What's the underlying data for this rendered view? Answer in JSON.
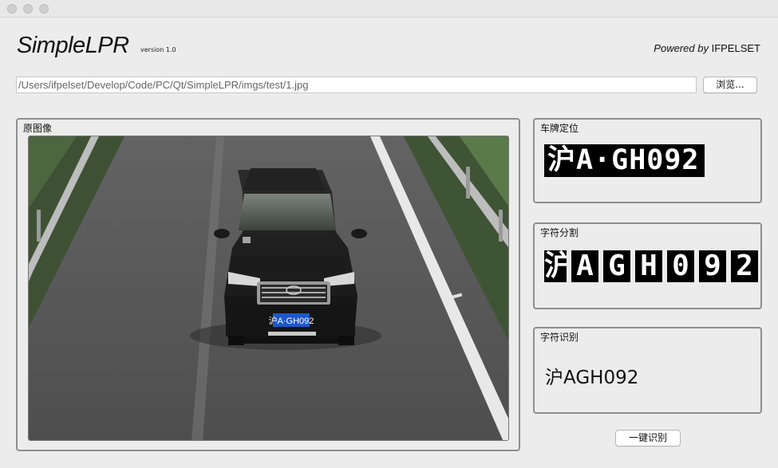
{
  "window": {
    "controls": [
      "close",
      "minimize",
      "zoom"
    ]
  },
  "header": {
    "title": "SimpleLPR",
    "version": "version 1.0",
    "powered_prefix": "Powered by",
    "powered_name": "IFPELSET"
  },
  "file": {
    "path": "/Users/ifpelset/Develop/Code/PC/Qt/SimpleLPR/imgs/test/1.jpg",
    "browse_label": "浏览..."
  },
  "groups": {
    "original_title": "原图像",
    "location_title": "车牌定位",
    "segmentation_title": "字符分割",
    "recognition_title": "字符识别"
  },
  "photo": {
    "plate_text": "沪A·GH092"
  },
  "location": {
    "plate": "沪A·GH092"
  },
  "segmentation": {
    "chars": [
      "沪",
      "A",
      "G",
      "H",
      "0",
      "9",
      "2"
    ]
  },
  "recognition": {
    "result": "沪AGH092"
  },
  "actions": {
    "recognize_label": "一键识别"
  },
  "colors": {
    "window_bg": "#ececec",
    "group_border": "#8e8e8e",
    "plate_bg": "#000000",
    "plate_fg": "#ffffff"
  }
}
